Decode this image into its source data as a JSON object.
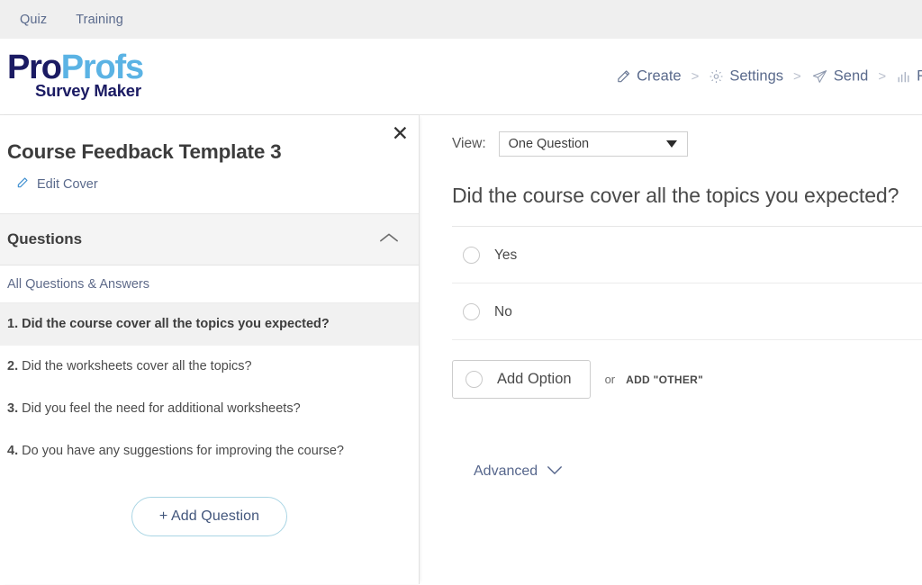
{
  "topbar": {
    "links": [
      {
        "label": "Quiz"
      },
      {
        "label": "Training"
      }
    ]
  },
  "header": {
    "logo": {
      "part1": "Pro",
      "part2": "Profs",
      "subtitle": "Survey Maker",
      "color_part1": "#1b1b63",
      "color_part2": "#5bb3e4"
    },
    "breadcrumb": [
      {
        "label": "Create",
        "icon": "pencil-icon"
      },
      {
        "label": "Settings",
        "icon": "gear-icon"
      },
      {
        "label": "Send",
        "icon": "paper-plane-icon"
      },
      {
        "label": "R",
        "icon": "bar-chart-icon"
      }
    ],
    "separator": ">"
  },
  "left_panel": {
    "title": "Course Feedback Template 3",
    "edit_cover_label": "Edit Cover",
    "close_label": "✕",
    "questions_section": {
      "header_label": "Questions",
      "all_qa_label": "All Questions & Answers",
      "items": [
        {
          "num": "1.",
          "text": "Did the course cover all the topics you expected?",
          "active": true
        },
        {
          "num": "2.",
          "text": "Did the worksheets cover all the topics?",
          "active": false
        },
        {
          "num": "3.",
          "text": "Did you feel the need for additional worksheets?",
          "active": false
        },
        {
          "num": "4.",
          "text": "Do you have any suggestions for improving the course?",
          "active": false
        }
      ]
    },
    "add_question_label": "+ Add Question"
  },
  "right_panel": {
    "view_label": "View:",
    "view_value": "One Question",
    "view_options": [
      "One Question"
    ],
    "question_title": "Did the course cover all the topics you expected?",
    "options": [
      {
        "label": "Yes"
      },
      {
        "label": "No"
      }
    ],
    "add_option_label": "Add Option",
    "or_label": "or",
    "add_other_label": "ADD \"OTHER\"",
    "advanced_label": "Advanced"
  },
  "colors": {
    "topbar_bg": "#efefef",
    "nav_link": "#5a6a8c",
    "accent_blue": "#5bb3e4",
    "navy": "#1b1b63",
    "active_row_bg": "#f1f1f1"
  }
}
